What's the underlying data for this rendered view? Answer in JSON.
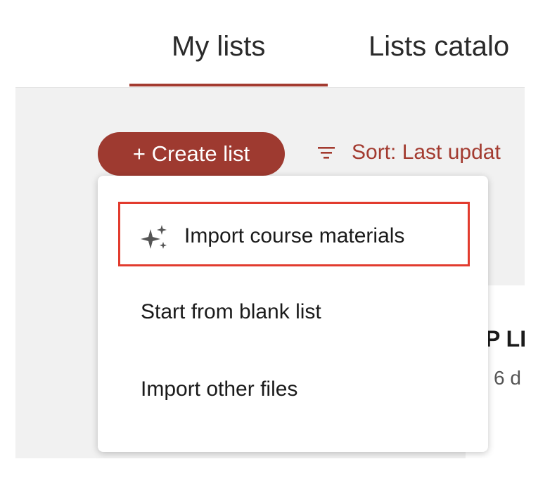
{
  "tabs": {
    "my_lists": "My lists",
    "catalog": "Lists catalo"
  },
  "toolbar": {
    "create_label": "+ Create list",
    "sort_label": "Sort: Last updat"
  },
  "menu": {
    "items": [
      {
        "label": "Import course materials",
        "icon": "sparkle-icon",
        "highlighted": true
      },
      {
        "label": "Start from blank list"
      },
      {
        "label": "Import other files"
      }
    ]
  },
  "card": {
    "title": "P LI",
    "subtitle": "6 d"
  },
  "colors": {
    "brand": "#9e3a30",
    "highlight": "#e23b2e"
  }
}
